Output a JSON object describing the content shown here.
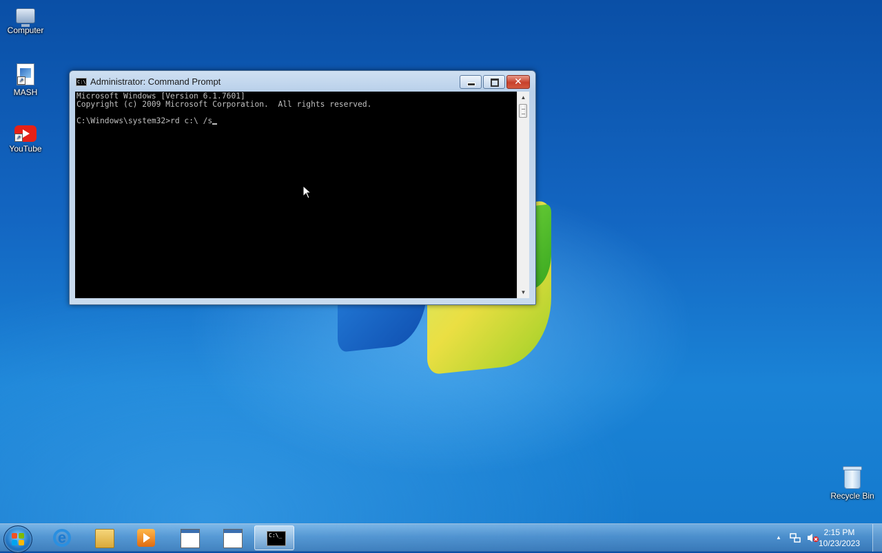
{
  "desktop": {
    "icons": [
      {
        "label": "Computer"
      },
      {
        "label": "MASH"
      },
      {
        "label": "YouTube"
      },
      {
        "label": "Recycle Bin"
      }
    ]
  },
  "window": {
    "title": "Administrator: Command Prompt",
    "icon_text": "C:\\",
    "console_lines": [
      "Microsoft Windows [Version 6.1.7601]",
      "Copyright (c) 2009 Microsoft Corporation.  All rights reserved.",
      "",
      "C:\\Windows\\system32>rd c:\\ /s"
    ],
    "close_glyph": "✕"
  },
  "taskbar": {
    "cmd_icon_text": "C:\\_",
    "tray_up_arrow": "▲",
    "clock_time": "2:15 PM",
    "clock_date": "10/23/2023"
  },
  "colors": {
    "desktop_blue": "#1366c2",
    "console_bg": "#000000",
    "console_fg": "#c0c0c0"
  }
}
